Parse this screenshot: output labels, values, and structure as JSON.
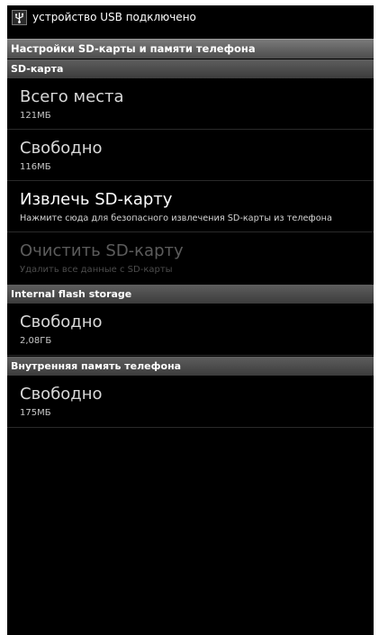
{
  "status_bar": {
    "notification_icon": "usb-icon",
    "text": "устройство USB подключено"
  },
  "title_bar": {
    "title": "Настройки SD-карты и памяти телефона"
  },
  "sections": [
    {
      "header": "SD-карта",
      "items": [
        {
          "title": "Всего места",
          "summary": "121МБ",
          "state": "normal"
        },
        {
          "title": "Свободно",
          "summary": "116МБ",
          "state": "normal"
        },
        {
          "title": "Извлечь SD-карту",
          "summary": "Нажмите сюда для безопасного извлечения SD-карты из телефона",
          "state": "enabled"
        },
        {
          "title": "Очистить SD-карту",
          "summary": "Удалить все данные с SD-карты",
          "state": "disabled"
        }
      ]
    },
    {
      "header": "Internal flash storage",
      "items": [
        {
          "title": "Свободно",
          "summary": "2,08ГБ",
          "state": "normal"
        }
      ]
    },
    {
      "header": "Внутренняя память телефона",
      "items": [
        {
          "title": "Свободно",
          "summary": "175МБ",
          "state": "normal"
        }
      ]
    }
  ],
  "colors": {
    "background": "#000000",
    "category_header": "#4a4a4a",
    "disabled_text": "#5c5c5c"
  }
}
